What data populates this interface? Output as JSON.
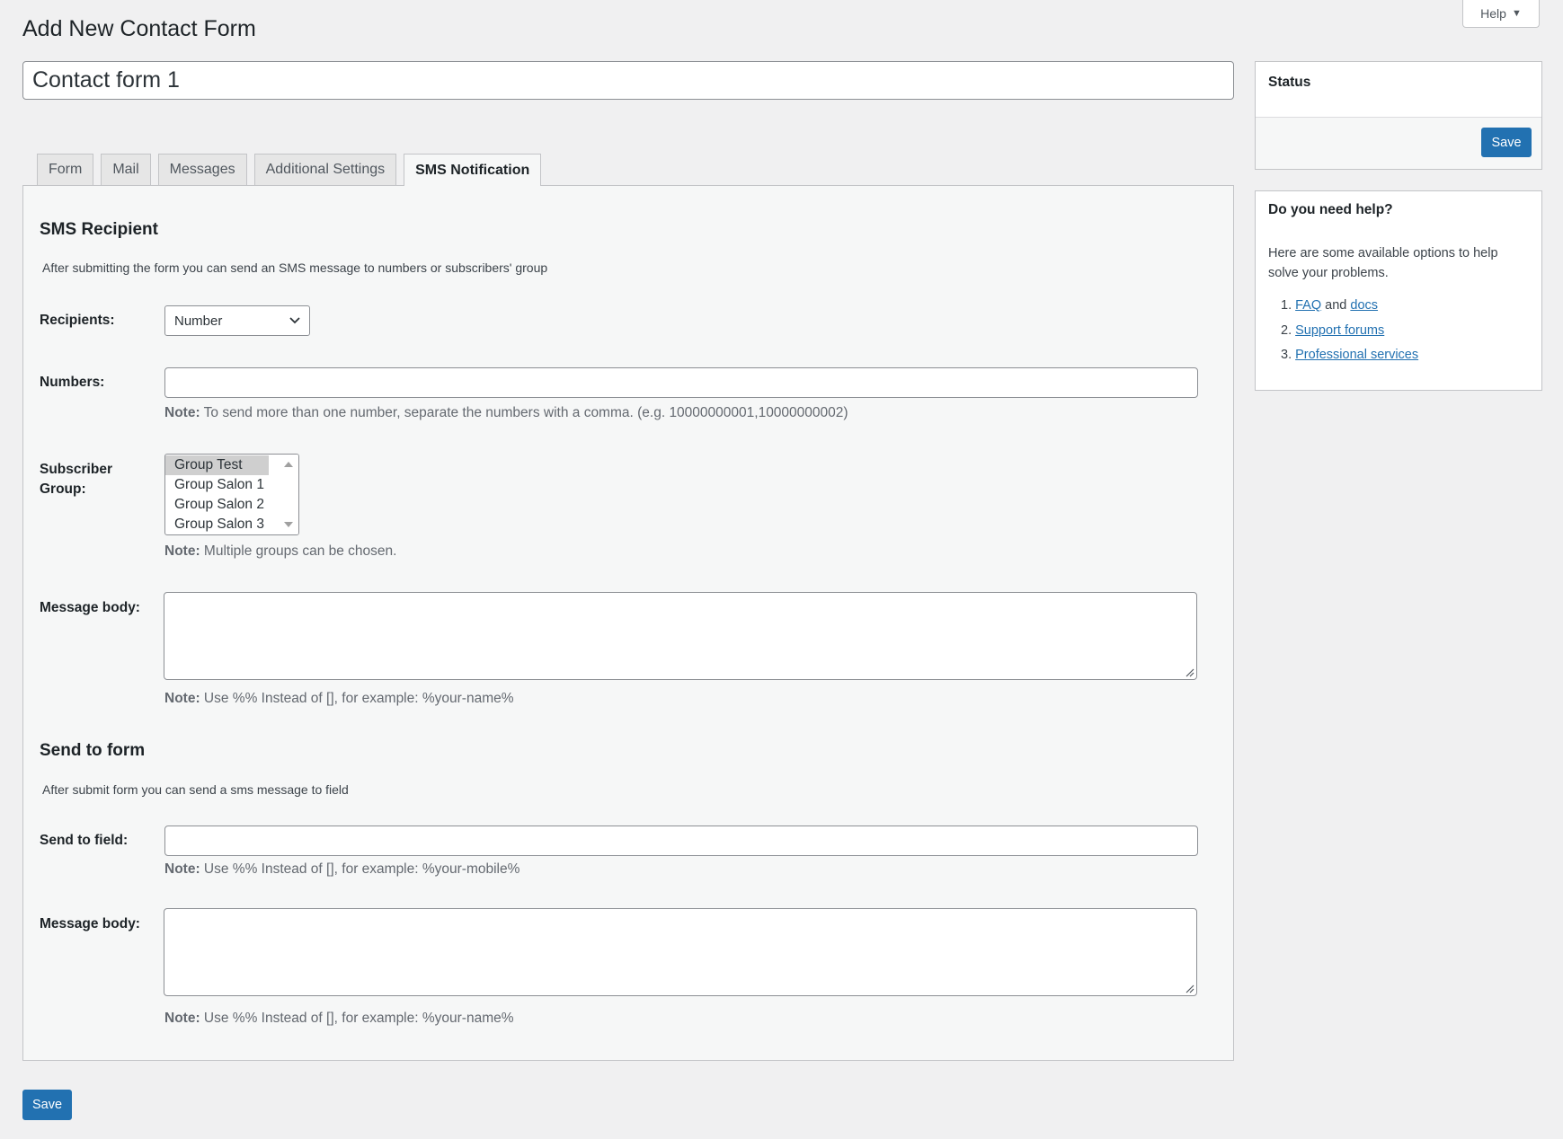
{
  "header": {
    "title": "Add New Contact Form",
    "help_label": "Help",
    "form_title_value": "Contact form 1"
  },
  "tabs": [
    {
      "label": "Form",
      "active": false
    },
    {
      "label": "Mail",
      "active": false
    },
    {
      "label": "Messages",
      "active": false
    },
    {
      "label": "Additional Settings",
      "active": false
    },
    {
      "label": "SMS Notification",
      "active": true
    }
  ],
  "sms_recipient": {
    "title": "SMS Recipient",
    "description": "After submitting the form you can send an SMS message to numbers or subscribers' group",
    "recipients_label": "Recipients:",
    "recipients_value": "Number",
    "numbers_label": "Numbers:",
    "numbers_value": "",
    "numbers_note_bold": "Note:",
    "numbers_note": " To send more than one number, separate the numbers with a comma. (e.g. 10000000001,10000000002)",
    "group_label": "Subscriber Group:",
    "groups": [
      {
        "label": "Group Test",
        "selected": true
      },
      {
        "label": "Group Salon 1",
        "selected": false
      },
      {
        "label": "Group Salon 2",
        "selected": false
      },
      {
        "label": "Group Salon 3",
        "selected": false
      }
    ],
    "group_note_bold": "Note:",
    "group_note": " Multiple groups can be chosen.",
    "message_label": "Message body:",
    "message_value": "",
    "message_note_bold": "Note:",
    "message_note": " Use %% Instead of [], for example: %your-name%"
  },
  "send_to_form": {
    "title": "Send to form",
    "description": "After submit form you can send a sms message to field",
    "field_label": "Send to field:",
    "field_value": "",
    "field_note_bold": "Note:",
    "field_note": " Use %% Instead of [], for example: %your-mobile%",
    "message_label": "Message body:",
    "message_value": "",
    "message_note_bold": "Note:",
    "message_note": " Use %% Instead of [], for example: %your-name%"
  },
  "save_label": "Save",
  "status_box": {
    "title": "Status",
    "save_label": "Save"
  },
  "help_box": {
    "title": "Do you need help?",
    "text": "Here are some available options to help solve your problems.",
    "item1_num": "1.",
    "item1_link_a": "FAQ",
    "item1_and": " and ",
    "item1_link_b": "docs",
    "item2_num": "2.",
    "item2_link": "Support forums",
    "item3_num": "3.",
    "item3_link": "Professional services"
  },
  "colors": {
    "primary": "#2271b1",
    "background": "#f0f0f1"
  }
}
